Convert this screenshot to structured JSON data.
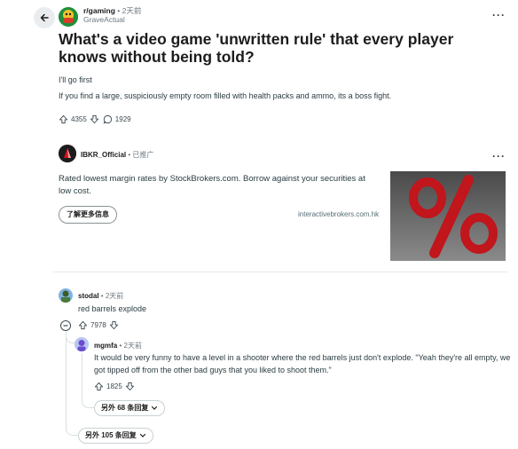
{
  "post": {
    "subreddit": "r/gaming",
    "time": "2天前",
    "author": "GraveActual",
    "title": "What's a video game 'unwritten rule' that every player knows without being told?",
    "body": [
      "I'll go first",
      "If you find a large, suspiciously empty room filled with health packs and ammo, its a boss fight."
    ],
    "votes": "4355",
    "comments": "1929"
  },
  "ad": {
    "advertiser": "IBKR_Official",
    "label": "已推广",
    "text": "Rated lowest margin rates by StockBrokers.com. Borrow against your securities at low cost.",
    "button": "了解更多信息",
    "domain": "interactivebrokers.com.hk",
    "image_symbol": "%"
  },
  "comments": [
    {
      "author": "stodal",
      "time": "2天前",
      "text": "red barrels explode",
      "votes": "7978",
      "more_replies": "另外 105 条回复",
      "replies": [
        {
          "author": "mgmfa",
          "time": "2天前",
          "text": "It would be very funny to have a level in a shooter where the red barrels just don't explode. \"Yeah they're all empty, we got tipped off from the other bad guys that you liked to shoot them.\"",
          "votes": "1825",
          "more_replies": "另外 68 条回复"
        }
      ]
    }
  ],
  "colors": {
    "accent": "#1f8f3a",
    "ad_brand": "#b5121b",
    "ad_image_symbol": "#c0161c"
  },
  "icons": [
    "back-arrow-icon",
    "upvote-icon",
    "downvote-icon",
    "comment-icon",
    "more-icon",
    "collapse-icon",
    "chevron-down-icon"
  ]
}
